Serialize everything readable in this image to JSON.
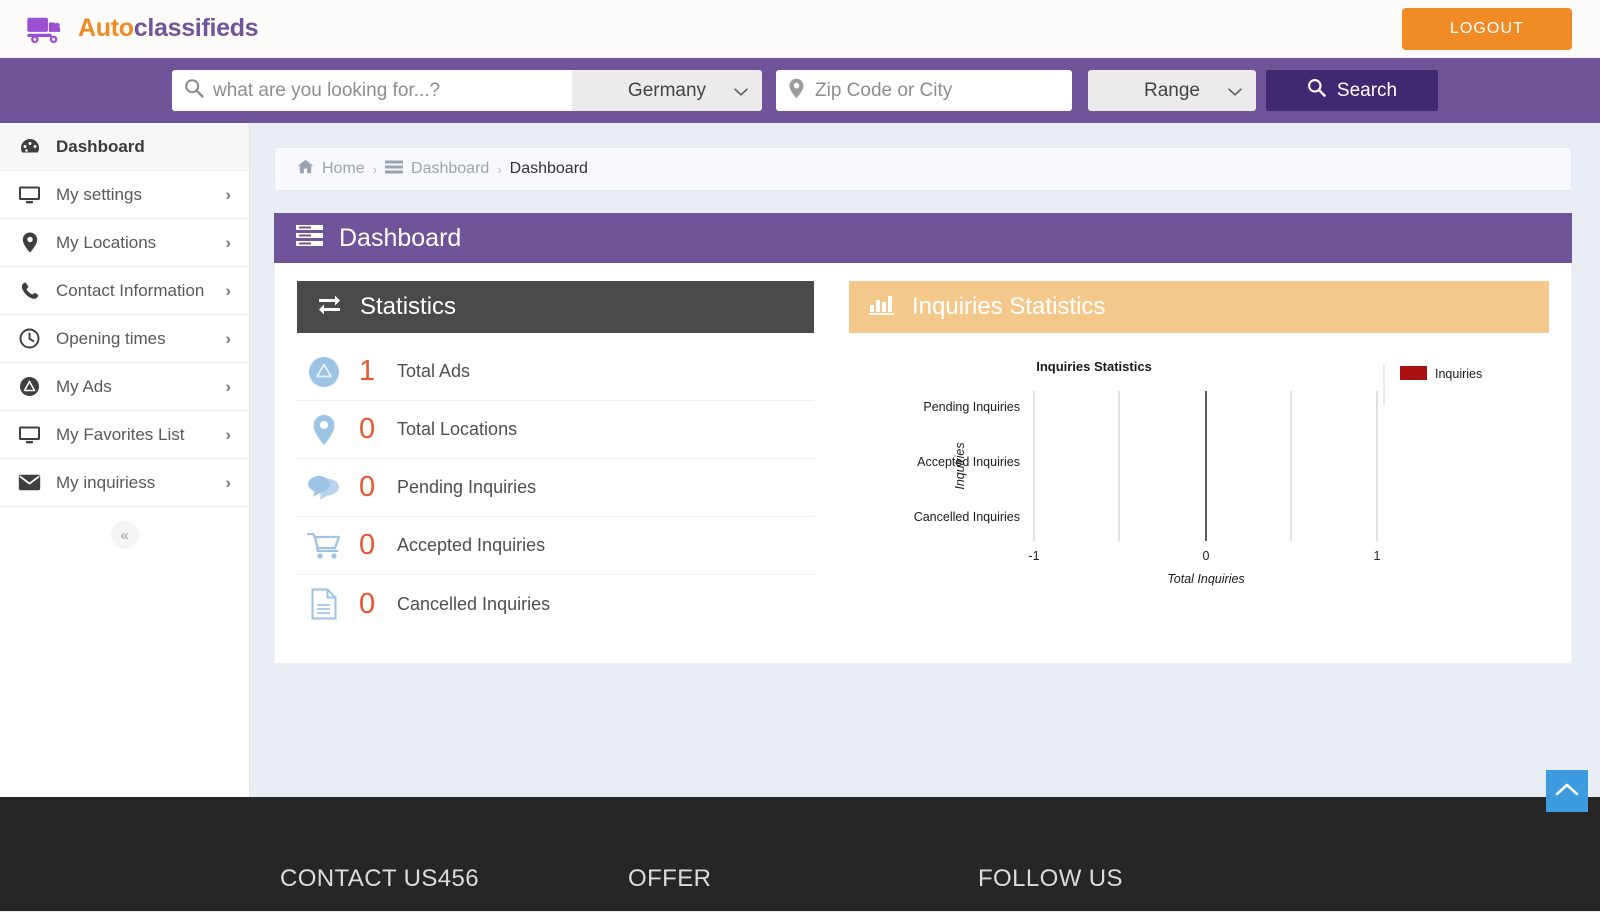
{
  "brand": {
    "part1": "Auto",
    "part2": "classifieds",
    "logo_icon": "truck-icon"
  },
  "header": {
    "logout_label": "LOGOUT"
  },
  "search": {
    "keyword_placeholder": "what are you looking for...?",
    "keyword_value": "",
    "country_value": "Germany",
    "zip_placeholder": "Zip Code or City",
    "zip_value": "",
    "range_value": "Range",
    "search_label": "Search",
    "search_icon": "search-icon",
    "pin_icon": "map-pin-icon",
    "chevron_icon": "chevron-down-icon"
  },
  "sidebar": {
    "items": [
      {
        "label": "Dashboard",
        "icon": "dashboard-gauge-icon",
        "active": true,
        "chevron": false
      },
      {
        "label": "My settings",
        "icon": "monitor-icon",
        "active": false,
        "chevron": true
      },
      {
        "label": "My Locations",
        "icon": "map-pin-icon",
        "active": false,
        "chevron": true
      },
      {
        "label": "Contact Information",
        "icon": "phone-icon",
        "active": false,
        "chevron": true
      },
      {
        "label": "Opening times",
        "icon": "clock-icon",
        "active": false,
        "chevron": true
      },
      {
        "label": "My Ads",
        "icon": "circle-up-icon",
        "active": false,
        "chevron": true
      },
      {
        "label": "My Favorites List",
        "icon": "monitor-icon",
        "active": false,
        "chevron": true
      },
      {
        "label": "My inquiriess",
        "icon": "envelope-icon",
        "active": false,
        "chevron": true
      }
    ],
    "collapse_icon": "double-chevron-left-icon"
  },
  "breadcrumb": {
    "home_label": "Home",
    "home_icon": "home-icon",
    "dashboard_label": "Dashboard",
    "dashboard_icon": "list-icon",
    "current_label": "Dashboard",
    "separator": "›"
  },
  "page": {
    "title": "Dashboard",
    "title_icon": "list-icon"
  },
  "statistics_card": {
    "title": "Statistics",
    "title_icon": "exchange-icon",
    "rows": [
      {
        "value": "1",
        "label": "Total Ads",
        "icon": "circle-up-icon"
      },
      {
        "value": "0",
        "label": "Total Locations",
        "icon": "map-pin-icon"
      },
      {
        "value": "0",
        "label": "Pending Inquiries",
        "icon": "chat-bubbles-icon"
      },
      {
        "value": "0",
        "label": "Accepted Inquiries",
        "icon": "shopping-cart-icon"
      },
      {
        "value": "0",
        "label": "Cancelled Inquiries",
        "icon": "document-icon"
      }
    ]
  },
  "inquiries_card": {
    "title": "Inquiries Statistics",
    "title_icon": "bar-chart-icon"
  },
  "chart_data": {
    "type": "bar",
    "orientation": "horizontal",
    "title": "Inquiries Statistics",
    "xlabel": "Total Inquiries",
    "ylabel": "Inquiries",
    "categories": [
      "Pending Inquiries",
      "Accepted Inquiries",
      "Cancelled Inquiries"
    ],
    "series": [
      {
        "name": "Inquiries",
        "color": "#a91010",
        "values": [
          0,
          0,
          0
        ]
      }
    ],
    "xlim": [
      -1.5,
      1.5
    ],
    "xticks": [
      -1,
      0,
      1
    ],
    "xtick_labels": [
      "-1",
      "0",
      "1"
    ],
    "gridlines_x": [
      -1,
      -0.5,
      0,
      0.5,
      1
    ],
    "grid": true,
    "legend": {
      "position": "right",
      "entries": [
        "Inquiries"
      ]
    }
  },
  "footer": {
    "columns": [
      {
        "heading": "CONTACT US456"
      },
      {
        "heading": "OFFER"
      },
      {
        "heading": "FOLLOW US"
      }
    ],
    "scrolltop_icon": "chevron-up-icon"
  },
  "colors": {
    "brand_purple": "#6f5499",
    "brand_orange": "#f18b26",
    "search_button": "#3f2a72",
    "stat_number": "#e8552f",
    "stat_icon": "#9dc4e4",
    "card_dark": "#4a4a4a",
    "card_peach": "#f4c88b",
    "chart_series": "#a91010",
    "footer_bg": "#262626",
    "scrolltop_bg": "#3d9ce0"
  }
}
